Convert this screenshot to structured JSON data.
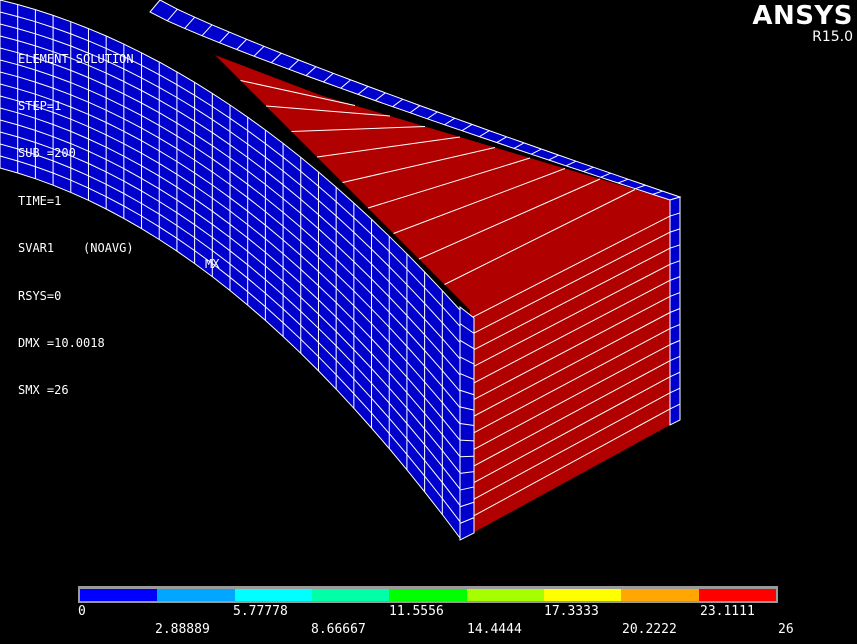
{
  "brand": {
    "name": "ANSYS",
    "version": "R15.0"
  },
  "info_lines": [
    "ELEMENT SOLUTION",
    "STEP=1",
    "SUB =200",
    "TIME=1",
    "SVAR1    (NOAVG)",
    "RSYS=0",
    "DMX =10.0018",
    "SMX =26"
  ],
  "mx_label": "MX",
  "legend": {
    "colors": [
      "#0000ff",
      "#00a6ff",
      "#00ffff",
      "#00ffa6",
      "#00ff00",
      "#a6ff00",
      "#ffff00",
      "#ffa600",
      "#ff0000"
    ],
    "ticks_top": [
      "0",
      "5.77778",
      "11.5556",
      "17.3333",
      "23.1111"
    ],
    "ticks_bottom": [
      "2.88889",
      "8.66667",
      "14.4444",
      "20.2222",
      "26"
    ]
  },
  "colors": {
    "background": "#000000",
    "mesh_blue": "#0000cc",
    "mesh_red": "#b00000",
    "grid_line": "#ffffff"
  }
}
